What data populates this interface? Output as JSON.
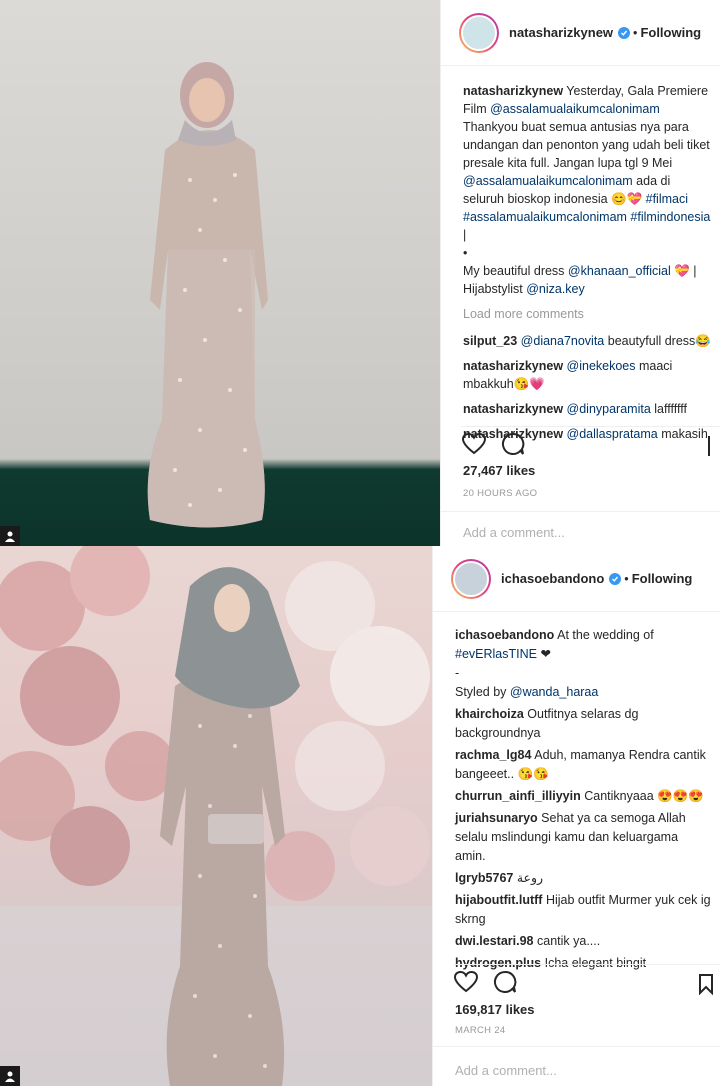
{
  "posts": [
    {
      "username": "natasharizkynew",
      "following_label": "Following",
      "caption_user": "natasharizkynew",
      "caption_parts": [
        "Yesterday, Gala Premiere Film ",
        "@assalamualaikumcalonimam",
        " Thankyou buat semua antusias nya para undangan dan penonton yang udah beli tiket presale kita full. Jangan lupa tgl 9 Mei ",
        "@assalamualaikumcalonimam",
        " ada di seluruh bioskop indonesia 😊💝 ",
        "#filmaci #assalamualaikumcalonimam #filmindonesia",
        " |",
        "•",
        "My beautiful dress ",
        "@khanaan_official",
        " 💝 | Hijabstylist ",
        "@niza.key"
      ],
      "load_more": "Load more comments",
      "comments": [
        {
          "user": "silput_23",
          "mention": "@diana7novita",
          "text": " beautyfull dress😂"
        },
        {
          "user": "natasharizkynew",
          "mention": "@inekekoes",
          "text": " maaci mbakkuh😘💗"
        },
        {
          "user": "natasharizkynew",
          "mention": "@dinyparamita",
          "text": " lafffffff"
        },
        {
          "user": "natasharizkynew",
          "mention": "@dallaspratama",
          "text": " makasih"
        }
      ],
      "likes": "27,467 likes",
      "time": "20 HOURS AGO",
      "add_comment_placeholder": "Add a comment..."
    },
    {
      "username": "ichasoebandono",
      "following_label": "Following",
      "caption_user": "ichasoebandono",
      "caption_parts": [
        "At the wedding of ",
        "#evERlasTINE",
        " ❤",
        "-",
        "Styled by ",
        "@wanda_haraa"
      ],
      "comments": [
        {
          "user": "khairchoiza",
          "text": "Outfitnya selaras dg backgroundnya"
        },
        {
          "user": "rachma_lg84",
          "text": "Aduh, mamanya Rendra cantik bangeeet.. 😘😘"
        },
        {
          "user": "churrun_ainfi_illiyyin",
          "text": "Cantiknyaaa 😍😍😍"
        },
        {
          "user": "juriahsunaryo",
          "text": "Sehat ya ca semoga Allah selalu mslindungi kamu dan keluargama amin."
        },
        {
          "user": "lgryb5767",
          "text": "روعة"
        },
        {
          "user": "hijaboutfit.lutff",
          "text": "Hijab outfit Murmer yuk cek ig skrng"
        },
        {
          "user": "dwi.lestari.98",
          "text": "cantik ya...."
        },
        {
          "user": "hydrogen.plus",
          "text": "Icha elegant bingit"
        }
      ],
      "likes": "169,817 likes",
      "time": "MARCH 24",
      "add_comment_placeholder": "Add a comment..."
    }
  ],
  "colors": {
    "link": "#003569",
    "verified": "#3897f0",
    "muted": "#999999"
  }
}
